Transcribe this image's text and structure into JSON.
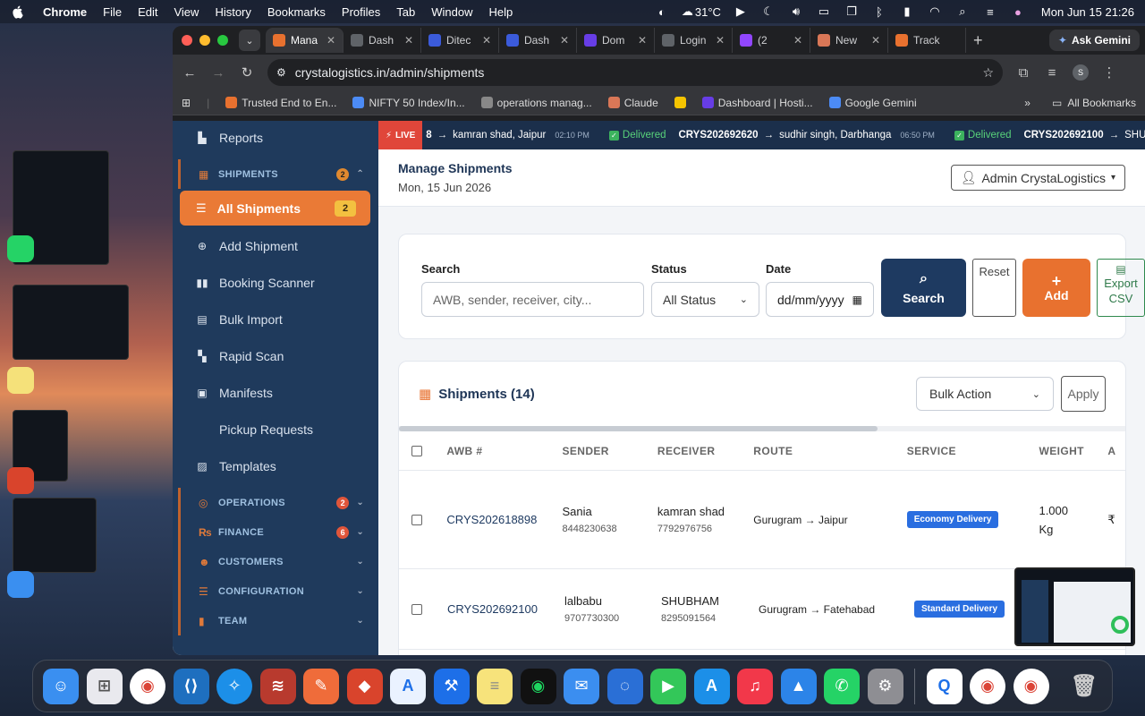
{
  "menubar": {
    "app": "Chrome",
    "items": [
      "File",
      "Edit",
      "View",
      "History",
      "Bookmarks",
      "Profiles",
      "Tab",
      "Window",
      "Help"
    ],
    "weather": "31°C",
    "clock": "Mon Jun 15  21:26"
  },
  "browser": {
    "tabs": [
      {
        "label": "Mana",
        "active": true,
        "color": "#e8712f"
      },
      {
        "label": "Dash",
        "active": false,
        "color": "#5f6368"
      },
      {
        "label": "Ditec",
        "active": false,
        "color": "#3b5bdb"
      },
      {
        "label": "Dash",
        "active": false,
        "color": "#3b5bdb"
      },
      {
        "label": "Dom",
        "active": false,
        "color": "#673de6"
      },
      {
        "label": "Login",
        "active": false,
        "color": "#5f6368"
      },
      {
        "label": "(2",
        "active": false,
        "color": "#9146ff"
      },
      {
        "label": "New",
        "active": false,
        "color": "#d97757"
      },
      {
        "label": "Track",
        "active": false,
        "color": "#e8712f"
      }
    ],
    "ask_gemini": "Ask Gemini",
    "url": "crystalogistics.in/admin/shipments",
    "profile_initial": "S",
    "bookmarks": [
      {
        "label": "Trusted End to En...",
        "color": "#e8712f"
      },
      {
        "label": "NIFTY 50 Index/In...",
        "color": "#4c8bf5"
      },
      {
        "label": "operations manag...",
        "color": "#888"
      },
      {
        "label": "Claude",
        "color": "#d97757"
      },
      {
        "label": "",
        "color": "#f5c400"
      },
      {
        "label": "Dashboard | Hosti...",
        "color": "#673de6"
      },
      {
        "label": "Google Gemini",
        "color": "#4c8bf5"
      }
    ],
    "all_bookmarks": "All Bookmarks"
  },
  "sidebar": {
    "reports": "Reports",
    "shipments_section": {
      "label": "SHIPMENTS",
      "badge": "2"
    },
    "active_item": {
      "label": "All Shipments",
      "badge": "2"
    },
    "items": [
      "Add Shipment",
      "Booking Scanner",
      "Bulk Import",
      "Rapid Scan",
      "Manifests",
      "Pickup Requests",
      "Templates"
    ],
    "sections": [
      {
        "label": "OPERATIONS",
        "badge": "2"
      },
      {
        "label": "FINANCE",
        "badge": "6"
      },
      {
        "label": "CUSTOMERS",
        "badge": ""
      },
      {
        "label": "CONFIGURATION",
        "badge": ""
      },
      {
        "label": "TEAM",
        "badge": ""
      }
    ]
  },
  "ticker": {
    "live": "LIVE",
    "first": {
      "awb_tail": "8",
      "receiver": "kamran shad, Jaipur",
      "time": "02:10 PM"
    },
    "second": {
      "status": "Delivered",
      "awb": "CRYS202692620",
      "receiver": "sudhir singh, Darbhanga",
      "time": "06:50 PM"
    },
    "third": {
      "status": "Delivered",
      "awb": "CRYS202692100",
      "receiver": "SHU"
    }
  },
  "header": {
    "title": "Manage Shipments",
    "date": "Mon, 15 Jun 2026",
    "admin": "Admin CrystaLogistics"
  },
  "filters": {
    "search_label": "Search",
    "search_placeholder": "AWB, sender, receiver, city...",
    "status_label": "Status",
    "status_value": "All Status",
    "date_label": "Date",
    "date_value": "dd/mm/yyyy",
    "search_btn": "Search",
    "reset_btn": "Reset",
    "add_btn": "Add",
    "export_btn_line1": "Export",
    "export_btn_line2": "CSV"
  },
  "table": {
    "title": "Shipments (14)",
    "bulk_action": "Bulk Action",
    "apply": "Apply",
    "columns": [
      "AWB #",
      "SENDER",
      "RECEIVER",
      "ROUTE",
      "SERVICE",
      "WEIGHT",
      "A"
    ],
    "rows": [
      {
        "awb": "CRYS202618898",
        "sender": "Sania",
        "sender_phone": "8448230638",
        "receiver": "kamran shad",
        "receiver_phone": "7792976756",
        "route": "Gurugram → Jaipur",
        "service": "Economy Delivery",
        "weight_1": "1.000",
        "weight_2": "Kg",
        "amount": "₹"
      },
      {
        "awb": "CRYS202692100",
        "sender": "lalbabu",
        "sender_phone": "9707730300",
        "receiver": "SHUBHAM",
        "receiver_phone": "8295091564",
        "route": "Gurugram → Fatehabad",
        "service": "Standard Delivery",
        "weight_1": "",
        "weight_2": "",
        "amount": ""
      }
    ]
  }
}
